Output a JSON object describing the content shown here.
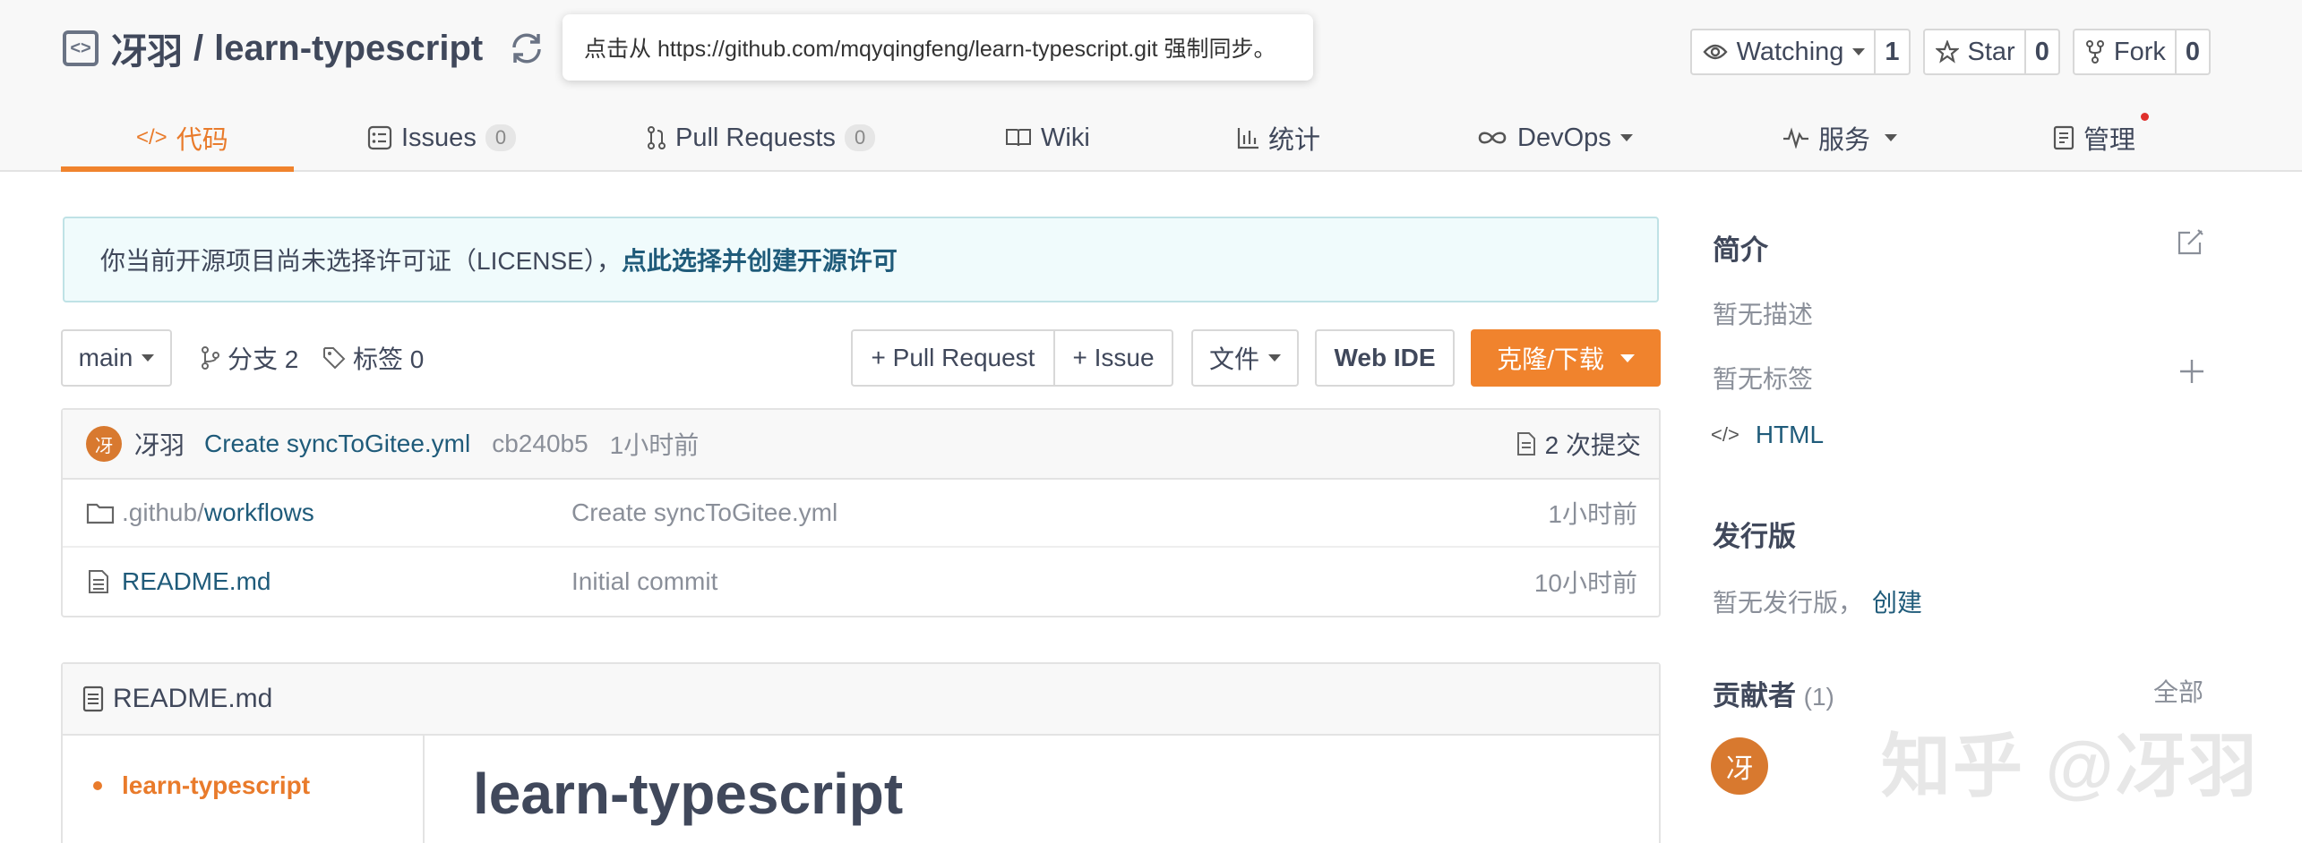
{
  "repo": {
    "owner": "冴羽",
    "separator": "/",
    "name": "learn-typescript"
  },
  "tooltip": {
    "text": "点击从 https://github.com/mqyqingfeng/learn-typescript.git 强制同步。"
  },
  "actions": {
    "watch": {
      "label": "Watching",
      "count": "1"
    },
    "star": {
      "label": "Star",
      "count": "0"
    },
    "fork": {
      "label": "Fork",
      "count": "0"
    }
  },
  "tabs": {
    "code": "代码",
    "issues": {
      "label": "Issues",
      "count": "0"
    },
    "pulls": {
      "label": "Pull Requests",
      "count": "0"
    },
    "wiki": "Wiki",
    "stats": "统计",
    "devops": "DevOps",
    "services": "服务",
    "manage": "管理"
  },
  "license": {
    "notice": "你当前开源项目尚未选择许可证（LICENSE），",
    "link": "点此选择并创建开源许可"
  },
  "toolbar": {
    "branch": "main",
    "branches": "分支 2",
    "tags": "标签 0",
    "pull_request": "+ Pull Request",
    "issue": "+ Issue",
    "files": "文件",
    "web_ide": "Web IDE",
    "clone": "克隆/下载"
  },
  "commit": {
    "avatar": "冴",
    "author": "冴羽",
    "message": "Create syncToGitee.yml",
    "hash": "cb240b5",
    "time": "1小时前",
    "count": "2 次提交"
  },
  "files": [
    {
      "prefix": ".github/",
      "name": "workflows",
      "message": "Create syncToGitee.yml",
      "time": "1小时前"
    },
    {
      "prefix": "",
      "name": "README.md",
      "message": "Initial commit",
      "time": "10小时前"
    }
  ],
  "readme": {
    "filename": "README.md",
    "toc_item": "learn-typescript",
    "heading": "learn-typescript"
  },
  "sidebar": {
    "intro_title": "简介",
    "no_description": "暂无描述",
    "no_tags": "暂无标签",
    "language": "HTML",
    "releases_title": "发行版",
    "no_releases": "暂无发行版，",
    "create_link": "创建",
    "contributors_title": "贡献者",
    "contributors_count": "(1)",
    "all_link": "全部",
    "contributor_avatar": "冴"
  },
  "watermark": "知乎 @冴羽",
  "colors": {
    "accent": "#f0832d",
    "link": "#1f5b7a",
    "badge_dot": "#e0302c"
  }
}
